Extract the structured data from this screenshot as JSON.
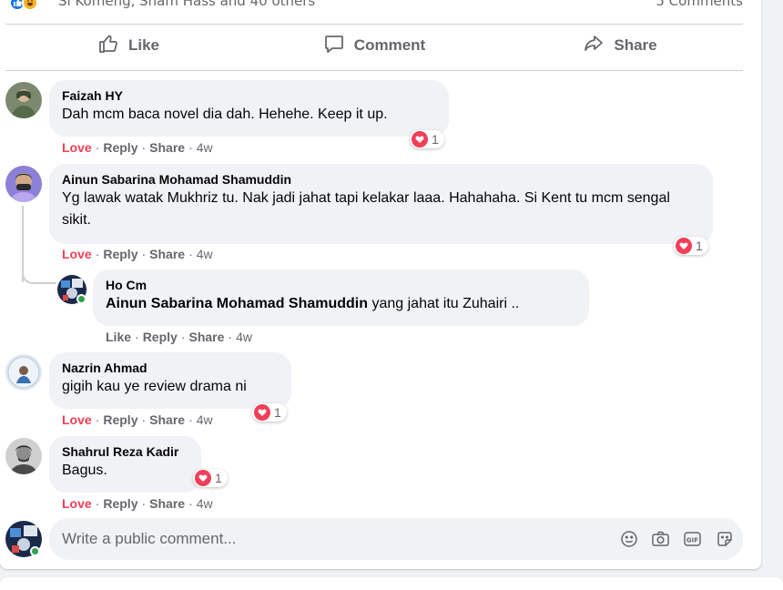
{
  "post": {
    "reactions_summary": "Si Komeng, Sham Hass and 40 others",
    "comments_count": "5 Comments",
    "actions": {
      "like": "Like",
      "comment": "Comment",
      "share": "Share"
    }
  },
  "comment_actions": {
    "love": "Love",
    "like": "Like",
    "reply": "Reply",
    "share": "Share",
    "dot": "·"
  },
  "comments": [
    {
      "name": "Faizah HY",
      "text": "Dah mcm baca novel dia dah. Hehehe. Keep it up.",
      "time": "4w",
      "reactions": "1"
    },
    {
      "name": "Ainun Sabarina Mohamad Shamuddin",
      "text": "Yg lawak watak Mukhriz tu. Nak jadi jahat tapi kelakar laaa. Hahahaha. Si Kent tu mcm sengal sikit.",
      "time": "4w",
      "reactions": "1",
      "reply": {
        "name": "Ho Cm",
        "mention": "Ainun Sabarina Mohamad Shamuddin",
        "text": "yang jahat itu Zuhairi ..",
        "time": "4w"
      }
    },
    {
      "name": "Nazrin Ahmad",
      "text": "gigih kau ye review drama ni",
      "time": "4w",
      "reactions": "1"
    },
    {
      "name": "Shahrul Reza Kadir",
      "text": "Bagus.",
      "time": "4w",
      "reactions": "1"
    }
  ],
  "composer": {
    "placeholder": "Write a public comment..."
  },
  "icons": [
    "like-icon",
    "comment-icon",
    "share-icon",
    "emoji-icon",
    "camera-icon",
    "gif-icon",
    "sticker-icon",
    "heart-icon"
  ],
  "colors": {
    "love": "#f33e58",
    "muted": "#65676b",
    "bubble": "#f0f2f5",
    "online": "#31a24c",
    "like_blue": "#1877f2"
  }
}
